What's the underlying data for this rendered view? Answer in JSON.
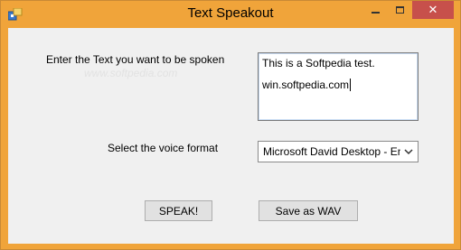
{
  "window": {
    "title": "Text Speakout",
    "close_glyph": "✕",
    "icons": {
      "app": "app-icon",
      "minimize": "minimize-icon",
      "maximize": "maximize-icon",
      "close": "close-icon"
    }
  },
  "form": {
    "text_label": "Enter the Text you want to be spoken",
    "text_lines": [
      "This is a Softpedia test.",
      "win.softpedia.com"
    ],
    "voice_label": "Select the voice format",
    "voice_selected": "Microsoft David Desktop - English (United States)",
    "speak_button": "SPEAK!",
    "save_button": "Save as WAV"
  },
  "watermark": "www.softpedia.com",
  "colors": {
    "titlebar": "#f0a43a",
    "close_button": "#c7504b",
    "client_bg": "#f0f0f0"
  }
}
